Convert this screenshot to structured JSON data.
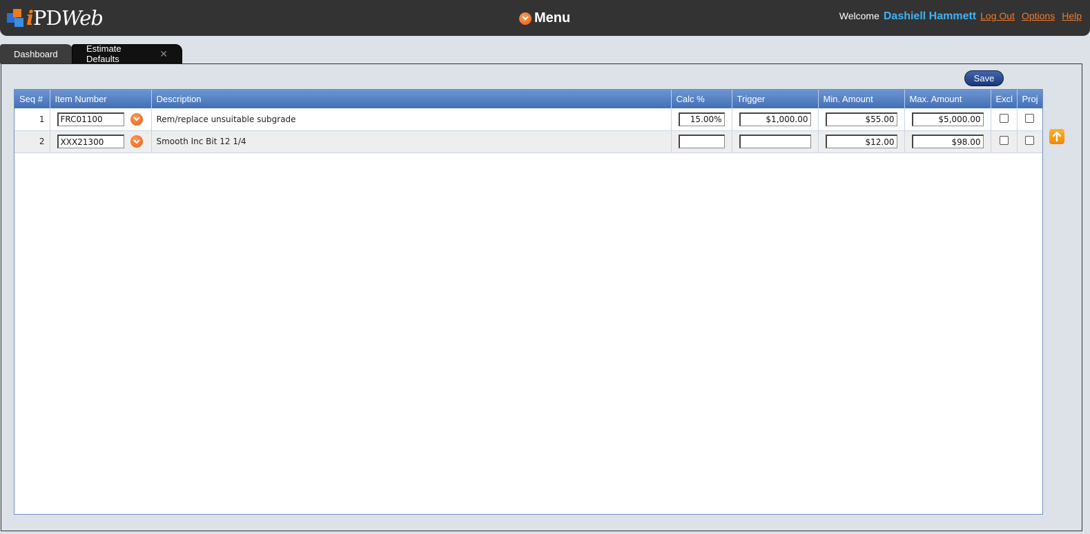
{
  "header": {
    "logo": {
      "i": "i",
      "pd": "PD",
      "web": "Web"
    },
    "menu_label": "Menu",
    "welcome": "Welcome",
    "user_name": "Dashiell Hammett",
    "logout": "Log Out",
    "options": "Options",
    "help": "Help"
  },
  "tabs": [
    {
      "label": "Dashboard"
    },
    {
      "label": "Estimate Defaults",
      "close": "✕"
    }
  ],
  "toolbar": {
    "save_label": "Save"
  },
  "grid": {
    "columns": [
      "Seq #",
      "Item Number",
      "Description",
      "Calc %",
      "Trigger",
      "Min. Amount",
      "Max. Amount",
      "Excl",
      "Proj"
    ],
    "rows": [
      {
        "seq": "1",
        "item": "FRC01100",
        "description": "Rem/replace unsuitable subgrade",
        "calc": "15.00%",
        "trigger": "$1,000.00",
        "min": "$55.00",
        "max": "$5,000.00"
      },
      {
        "seq": "2",
        "item": "XXX21300",
        "description": "Smooth Inc Bit 12 1/4",
        "calc": "",
        "trigger": "",
        "min": "$12.00",
        "max": "$98.00"
      }
    ]
  },
  "icons": {
    "lookup": "chevron-down-circle-icon",
    "scroll": "arrow-up-icon",
    "brand_orange": "#f07b1a",
    "accent_blue": "#4270b6"
  }
}
